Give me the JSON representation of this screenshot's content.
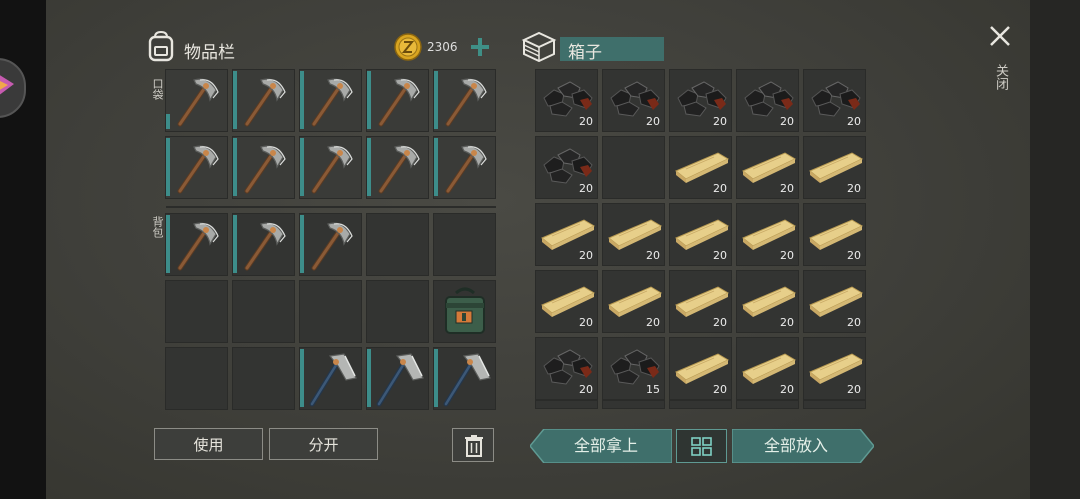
{
  "inventory": {
    "title": "物品栏",
    "coins": "2306",
    "pocket_label": "口袋",
    "backpack_label": "背包",
    "pocket_slots": [
      {
        "item": "pickaxe",
        "wear": 0.25
      },
      {
        "item": "pickaxe",
        "wear": 1
      },
      {
        "item": "pickaxe",
        "wear": 1
      },
      {
        "item": "pickaxe",
        "wear": 1
      },
      {
        "item": "pickaxe",
        "wear": 1
      },
      {
        "item": "pickaxe",
        "wear": 1
      },
      {
        "item": "pickaxe",
        "wear": 1
      },
      {
        "item": "pickaxe",
        "wear": 1
      },
      {
        "item": "pickaxe",
        "wear": 1
      },
      {
        "item": "pickaxe",
        "wear": 1
      }
    ],
    "backpack_slots": [
      {
        "item": "pickaxe",
        "wear": 1
      },
      {
        "item": "pickaxe",
        "wear": 1
      },
      {
        "item": "pickaxe",
        "wear": 1
      },
      {
        "item": ""
      },
      {
        "item": ""
      },
      {
        "item": ""
      },
      {
        "item": ""
      },
      {
        "item": ""
      },
      {
        "item": ""
      },
      {
        "item": "green-bag"
      },
      {
        "item": ""
      },
      {
        "item": ""
      },
      {
        "item": "hatchet",
        "wear": 1
      },
      {
        "item": "hatchet",
        "wear": 1
      },
      {
        "item": "hatchet",
        "wear": 1
      }
    ],
    "use_button": "使用",
    "split_button": "分开"
  },
  "box": {
    "title": "箱子",
    "slots": [
      {
        "item": "coal",
        "qty": "20"
      },
      {
        "item": "coal",
        "qty": "20"
      },
      {
        "item": "coal",
        "qty": "20"
      },
      {
        "item": "coal",
        "qty": "20"
      },
      {
        "item": "coal",
        "qty": "20"
      },
      {
        "item": "coal",
        "qty": "20"
      },
      {
        "item": "",
        "qty": ""
      },
      {
        "item": "plank",
        "qty": "20"
      },
      {
        "item": "plank",
        "qty": "20"
      },
      {
        "item": "plank",
        "qty": "20"
      },
      {
        "item": "plank",
        "qty": "20"
      },
      {
        "item": "plank",
        "qty": "20"
      },
      {
        "item": "plank",
        "qty": "20"
      },
      {
        "item": "plank",
        "qty": "20"
      },
      {
        "item": "plank",
        "qty": "20"
      },
      {
        "item": "plank",
        "qty": "20"
      },
      {
        "item": "plank",
        "qty": "20"
      },
      {
        "item": "plank",
        "qty": "20"
      },
      {
        "item": "plank",
        "qty": "20"
      },
      {
        "item": "plank",
        "qty": "20"
      },
      {
        "item": "coal",
        "qty": "20"
      },
      {
        "item": "coal",
        "qty": "15"
      },
      {
        "item": "plank",
        "qty": "20"
      },
      {
        "item": "plank",
        "qty": "20"
      },
      {
        "item": "plank",
        "qty": "20"
      }
    ],
    "take_all_button": "全部拿上",
    "put_all_button": "全部放入"
  },
  "close_label": "关闭",
  "colors": {
    "accent": "#3f6f6b",
    "wear_bar": "#3d8d8a",
    "coin": "#d9a520"
  },
  "icons": {
    "backpack": "backpack-icon",
    "coin": "coin-icon",
    "add": "plus-icon",
    "box": "box-icon",
    "close": "close-icon",
    "sort": "grid-sort-icon",
    "trash": "trash-icon"
  }
}
